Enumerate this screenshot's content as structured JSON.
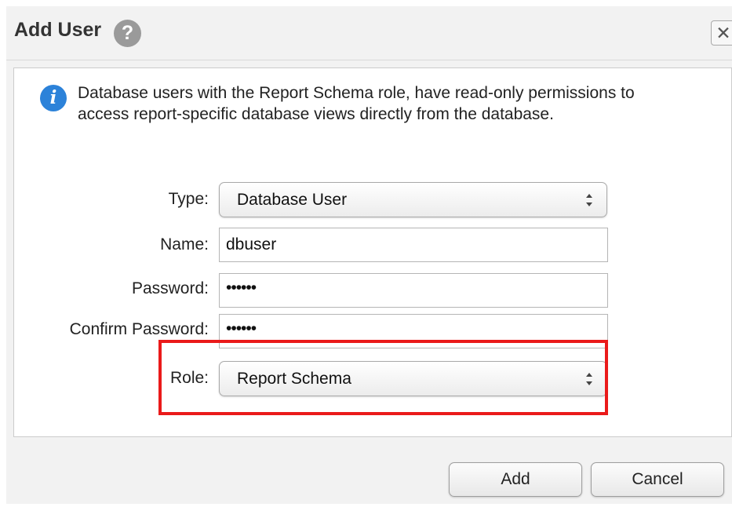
{
  "dialog": {
    "title": "Add User",
    "help_icon": "question-icon",
    "close_icon": "close-icon",
    "close_symbol": "✕"
  },
  "info": {
    "icon": "info-icon",
    "icon_symbol": "i",
    "text": "Database users with the Report Schema role, have read-only permissions to access report-specific database views directly from the database."
  },
  "form": {
    "type": {
      "label": "Type:",
      "value": "Database User"
    },
    "name": {
      "label": "Name:",
      "value": "dbuser"
    },
    "password": {
      "label": "Password:",
      "value": "••••••"
    },
    "confirm_password": {
      "label": "Confirm Password:",
      "value": "••••••"
    },
    "role": {
      "label": "Role:",
      "value": "Report Schema"
    }
  },
  "buttons": {
    "add_label": "Add",
    "cancel_label": "Cancel"
  },
  "colors": {
    "highlight": "#ea1a1a",
    "info_icon": "#2c82d9",
    "help_icon": "#9a9a9a"
  }
}
